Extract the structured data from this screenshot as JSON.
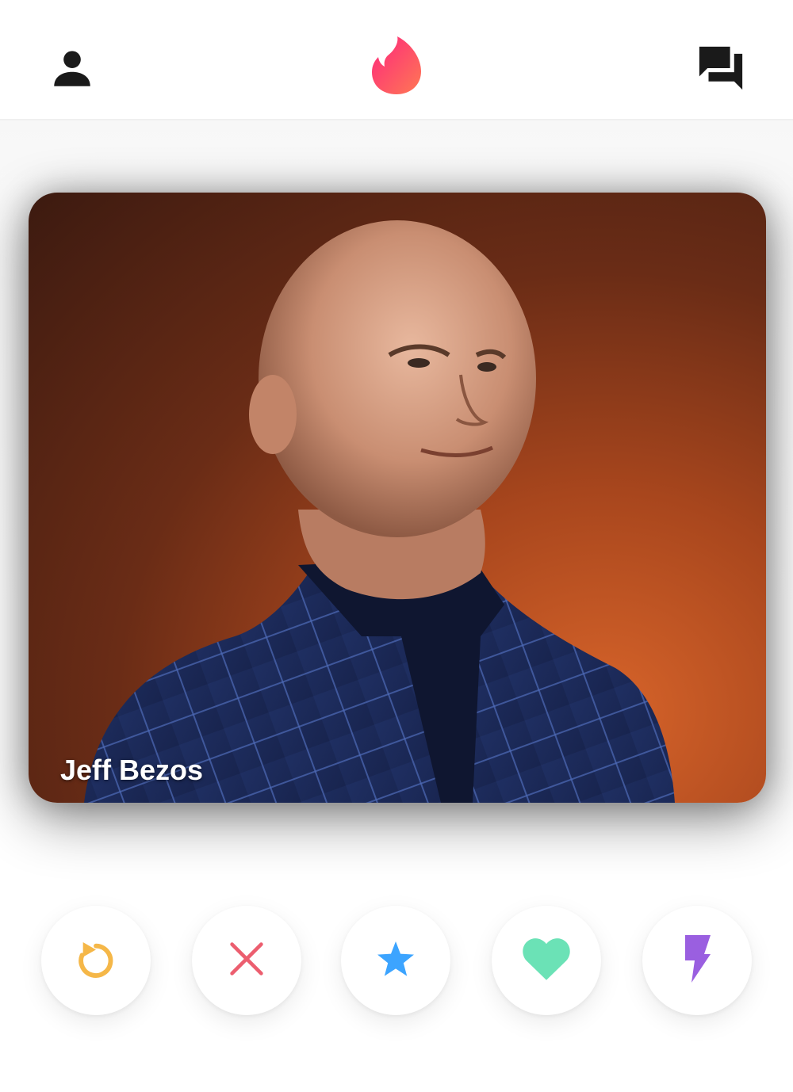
{
  "header": {
    "profile_icon": "person-icon",
    "logo_icon": "flame-logo-icon",
    "messages_icon": "chat-bubbles-icon"
  },
  "card": {
    "name": "Jeff Bezos"
  },
  "actions": [
    {
      "name": "rewind",
      "icon": "rewind-icon",
      "color": "#f5b748"
    },
    {
      "name": "nope",
      "icon": "close-icon",
      "color": "#ec5e6f"
    },
    {
      "name": "super-like",
      "icon": "star-icon",
      "color": "#3ca4ff"
    },
    {
      "name": "like",
      "icon": "heart-icon",
      "color": "#6be2b6"
    },
    {
      "name": "boost",
      "icon": "bolt-icon",
      "color": "#9a5fe0"
    }
  ],
  "colors": {
    "brand_gradient_start": "#fd267d",
    "brand_gradient_end": "#ff7854"
  }
}
